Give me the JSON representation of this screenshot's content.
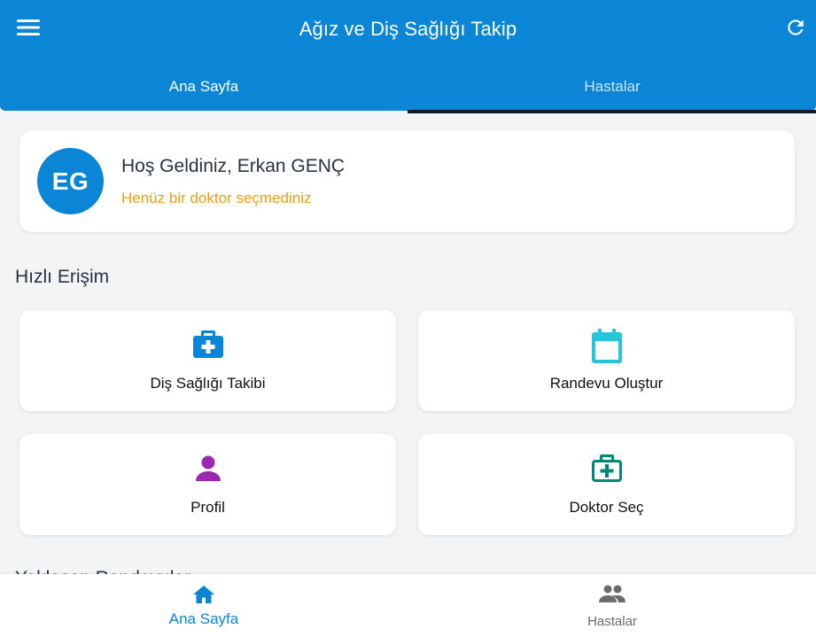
{
  "header": {
    "title": "Ağız ve Diş Sağlığı Takip",
    "menu_icon": "menu-icon",
    "refresh_icon": "refresh-icon",
    "background_color": "#0b86d6",
    "tabs": [
      {
        "label": "Ana Sayfa",
        "active": true
      },
      {
        "label": "Hastalar",
        "active": false
      }
    ]
  },
  "welcome": {
    "avatar_initials": "EG",
    "title": "Hoş Geldiniz, Erkan GENÇ",
    "subtitle": "Henüz bir doktor seçmediniz",
    "subtitle_color": "#f59e0b"
  },
  "quick_access": {
    "title": "Hızlı Erişim",
    "items": [
      {
        "label": "Diş Sağlığı Takibi",
        "icon": "medical-bag-icon",
        "color": "#0b86d6"
      },
      {
        "label": "Randevu Oluştur",
        "icon": "calendar-icon",
        "color": "#26c6da"
      },
      {
        "label": "Profil",
        "icon": "person-icon",
        "color": "#9c27b0"
      },
      {
        "label": "Doktor Seç",
        "icon": "medical-kit-icon",
        "color": "#00897b"
      }
    ]
  },
  "next_section_title": "Yaklaşan Randevular",
  "bottom_nav": {
    "items": [
      {
        "label": "Ana Sayfa",
        "icon": "home-icon",
        "active": true
      },
      {
        "label": "Hastalar",
        "icon": "people-icon",
        "active": false
      }
    ],
    "active_color": "#0b86d6",
    "inactive_color": "#6b6b6b"
  }
}
